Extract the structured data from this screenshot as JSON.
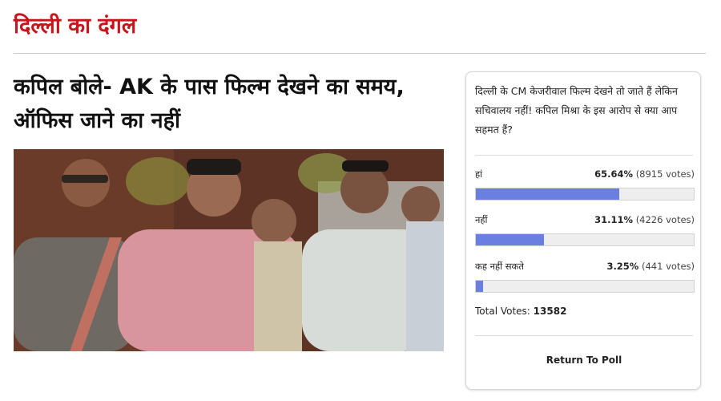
{
  "section": {
    "title": "दिल्ली का दंगल"
  },
  "article": {
    "headline": "कपिल बोले- AK के पास फिल्म देखने का समय, ऑफिस जाने का नहीं"
  },
  "poll": {
    "question": "दिल्ली के CM केजरीवाल फिल्म देखने तो जाते हैं लेकिन सचिवालय नहीं! कपिल मिश्रा के इस आरोप से क्या आप सहमत हैं?",
    "options": [
      {
        "label": "हां",
        "percent_text": "65.64%",
        "votes_text": "(8915 votes)",
        "fraction": 0.6564
      },
      {
        "label": "नहीं",
        "percent_text": "31.11%",
        "votes_text": "(4226 votes)",
        "fraction": 0.3111
      },
      {
        "label": "कह नहीं सकते",
        "percent_text": "3.25%",
        "votes_text": "(441 votes)",
        "fraction": 0.0325
      }
    ],
    "total_label": "Total Votes:",
    "total_value": "13582",
    "return_label": "Return To Poll",
    "bar_color": "#6a7fe0"
  },
  "colors": {
    "accent": "#c8151b"
  }
}
